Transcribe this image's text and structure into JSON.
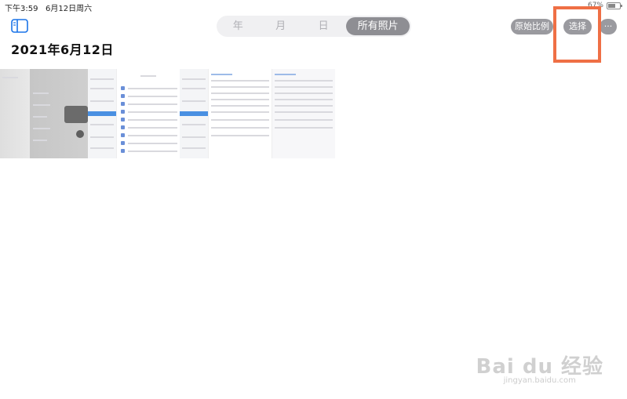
{
  "status_bar": {
    "time": "下午3:59",
    "date": "6月12日周六",
    "battery": "67%",
    "battery_level": 0.67
  },
  "title": "2021年6月12日",
  "segments": [
    {
      "label": "年",
      "active": false
    },
    {
      "label": "月",
      "active": false
    },
    {
      "label": "日",
      "active": false
    },
    {
      "label": "所有照片",
      "active": true
    }
  ],
  "toolbar": {
    "ratio_label": "原始比例",
    "select_label": "选择",
    "more_label": "···"
  },
  "watermark": {
    "main": "Bai du 经验",
    "sub": "jingyan.baidu.com"
  },
  "colors": {
    "highlight": "#ef6f45",
    "pill": "#9a9a9f",
    "accent": "#4a90e2"
  }
}
